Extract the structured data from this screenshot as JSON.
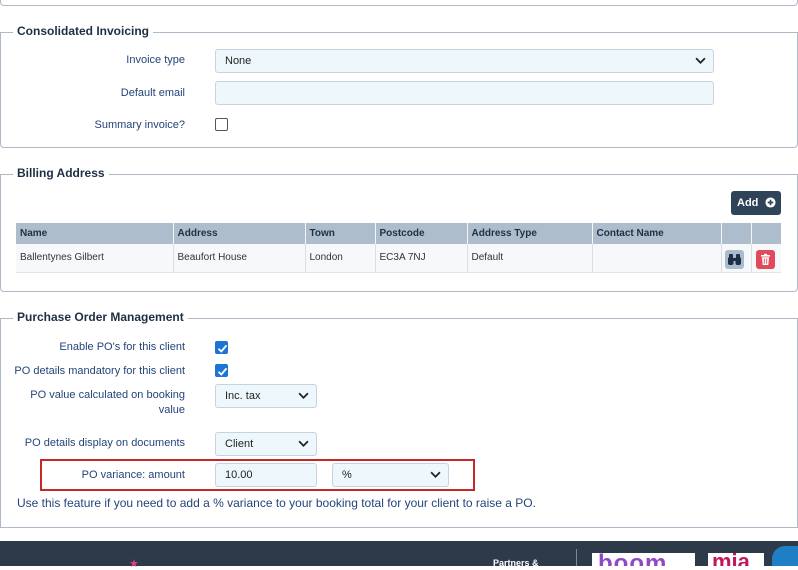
{
  "consolidated": {
    "legend": "Consolidated Invoicing",
    "invoice_type_label": "Invoice type",
    "invoice_type_value": "None",
    "default_email_label": "Default email",
    "default_email_value": "",
    "summary_label": "Summary invoice?",
    "summary_checked": false
  },
  "billing": {
    "legend": "Billing Address",
    "add_label": "Add",
    "columns": [
      "Name",
      "Address",
      "Town",
      "Postcode",
      "Address Type",
      "Contact Name",
      "",
      ""
    ],
    "rows": [
      {
        "name": "Ballentynes Gilbert",
        "address": "Beaufort House",
        "town": "London",
        "postcode": "EC3A 7NJ",
        "type": "Default",
        "contact": ""
      }
    ]
  },
  "po": {
    "legend": "Purchase Order Management",
    "enable_label": "Enable PO's for this client",
    "enable_checked": true,
    "mandatory_label": "PO details mandatory for this client",
    "mandatory_checked": true,
    "value_calc_label": "PO value calculated on booking value",
    "value_calc_value": "Inc. tax",
    "display_label": "PO details display on documents",
    "display_value": "Client",
    "variance_label": "PO variance: amount",
    "variance_amount": "10.00",
    "variance_unit": "%",
    "help_text": "Use this feature if you need to add a % variance to your booking total for your client to raise a PO."
  },
  "footer": {
    "partners_text": "Partners &",
    "logo_boom": "boom",
    "logo_mia": "mia"
  },
  "colors": {
    "accent": "#1d73d6",
    "delete": "#e04a5a",
    "highlight_box": "#c62828",
    "footer_bg": "#2c3a49"
  }
}
